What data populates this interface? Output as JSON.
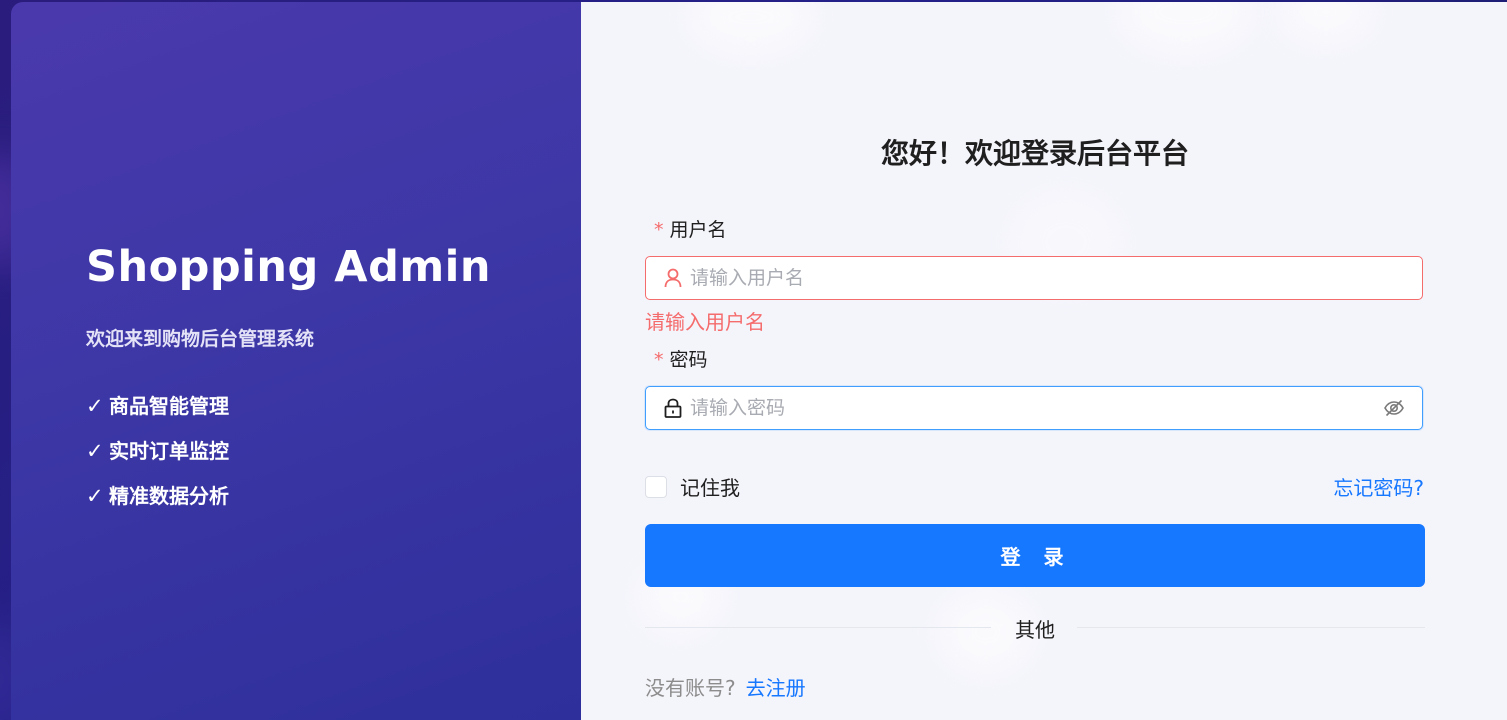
{
  "brand": {
    "title": "Shopping Admin",
    "subtitle": "欢迎来到购物后台管理系统",
    "features": [
      {
        "check": "✓",
        "text": "商品智能管理"
      },
      {
        "check": "✓",
        "text": "实时订单监控"
      },
      {
        "check": "✓",
        "text": "精准数据分析"
      }
    ]
  },
  "form": {
    "heading": "您好！欢迎登录后台平台",
    "username": {
      "required_mark": "*",
      "label": "用户名",
      "placeholder": "请输入用户名",
      "value": "",
      "icon": "user-icon",
      "error": "请输入用户名"
    },
    "password": {
      "required_mark": "*",
      "label": "密码",
      "placeholder": "请输入密码",
      "value": "",
      "icon": "lock-icon",
      "toggle_icon": "eye-off-icon"
    },
    "remember_label": "记住我",
    "remember_checked": false,
    "forgot_link": "忘记密码?",
    "login_button": "登 录",
    "divider_text": "其他",
    "register_prompt": "没有账号?",
    "register_link": "去注册"
  },
  "colors": {
    "primary": "#1677ff",
    "error": "#f56c6c",
    "left_panel": "#3d37a6"
  }
}
